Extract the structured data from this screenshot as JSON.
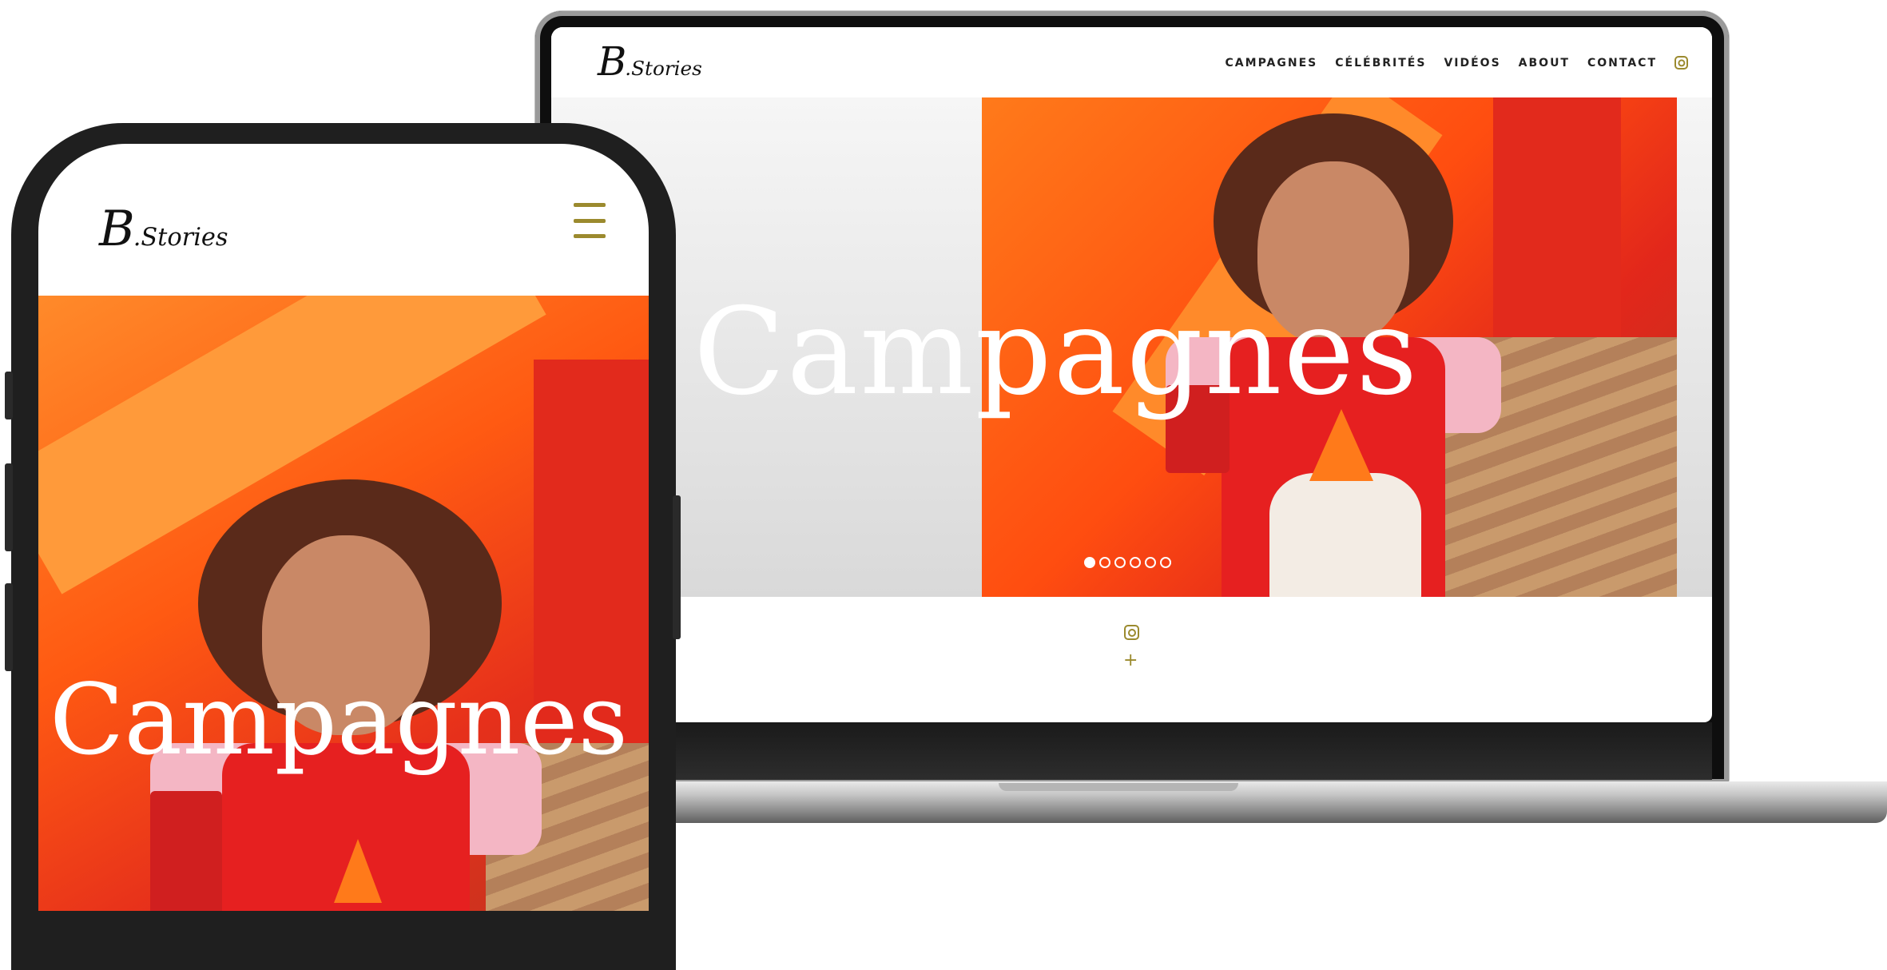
{
  "laptop": {
    "logo_big": "B",
    "logo_small": ".Stories",
    "nav": [
      "CAMPAGNES",
      "CÉLÉBRITÉS",
      "VIDÉOS",
      "ABOUT",
      "CONTACT"
    ],
    "hero_title": "Campagnes",
    "slider_dots": 6,
    "active_dot": 1,
    "footer_plus": "+"
  },
  "phone": {
    "logo_big": "B",
    "logo_small": ".Stories",
    "hero_title": "Campagnes"
  },
  "colors": {
    "accent": "#9b8a2e",
    "hero_orange": "#ff5a12",
    "hero_red": "#e62020"
  },
  "icons": [
    "instagram-icon",
    "hamburger-menu-icon",
    "plus-icon"
  ]
}
